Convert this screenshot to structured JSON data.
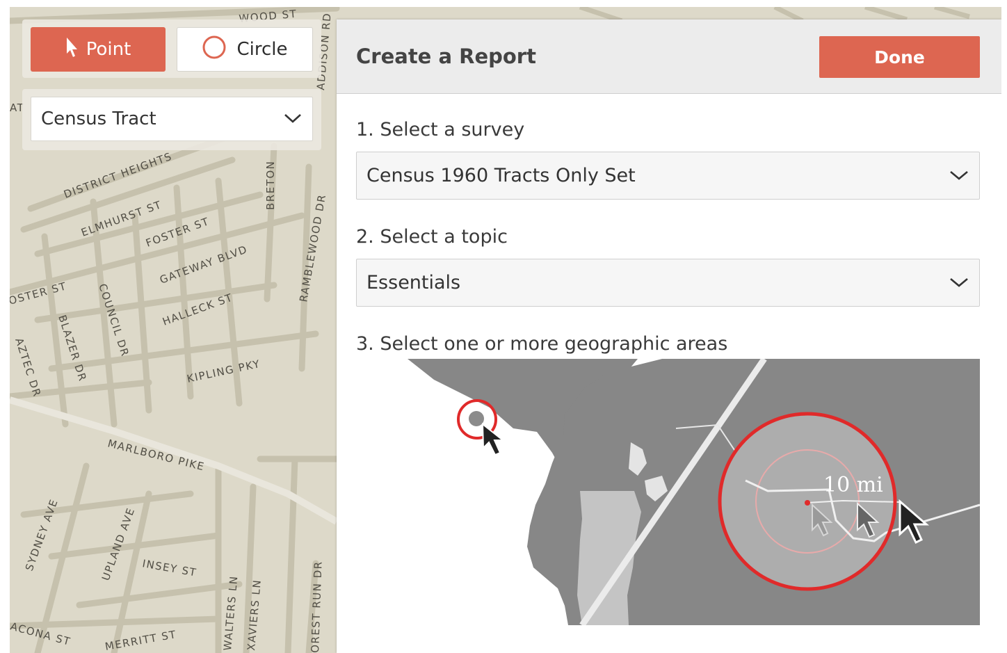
{
  "tools": {
    "point_label": "Point",
    "circle_label": "Circle",
    "geography_select": "Census Tract"
  },
  "report": {
    "title": "Create a Report",
    "done_label": "Done",
    "step1_label": "1. Select a survey",
    "survey_value": "Census 1960 Tracts Only Set",
    "step2_label": "2. Select a topic",
    "topic_value": "Essentials",
    "step3_label": "3. Select one or more geographic areas",
    "radius_label": "10 mi"
  },
  "map": {
    "streets": {
      "s0": "DISTRICT HEIGHTS",
      "s1": "ELMHURST ST",
      "s2": "FOSTER ST",
      "s3": "GATEWAY BLVD",
      "s4": "HALLECK ST",
      "s5": "OSTER ST",
      "s6": "BLAZER DR",
      "s7": "COUNCIL DR",
      "s8": "AZTEC DR",
      "s9": "KIPLING PKY",
      "s10": "MARLBORO PIKE",
      "s11": "SYDNEY AVE",
      "s12": "UPLAND AVE",
      "s13": "INSEY ST",
      "s14": "WALTERS LN",
      "s15": "XAVIERS LN",
      "s16": "OREST RUN DR",
      "s17": "MERRITT ST",
      "s18": "ACONA ST",
      "s19": "BRETON",
      "s20": "RAMBLEWOOD DR",
      "s21": "ADDISON RD",
      "s22": "WOOD ST",
      "s23": "AT"
    }
  },
  "colors": {
    "accent": "#dd6651",
    "map_bg": "#ddd9c9",
    "road": "#c6c1ad",
    "circle_red": "#e02a2a"
  },
  "icons": {
    "point": "cursor-arrow-icon",
    "circle": "circle-outline-icon",
    "dropdown": "chevron-down-icon"
  }
}
